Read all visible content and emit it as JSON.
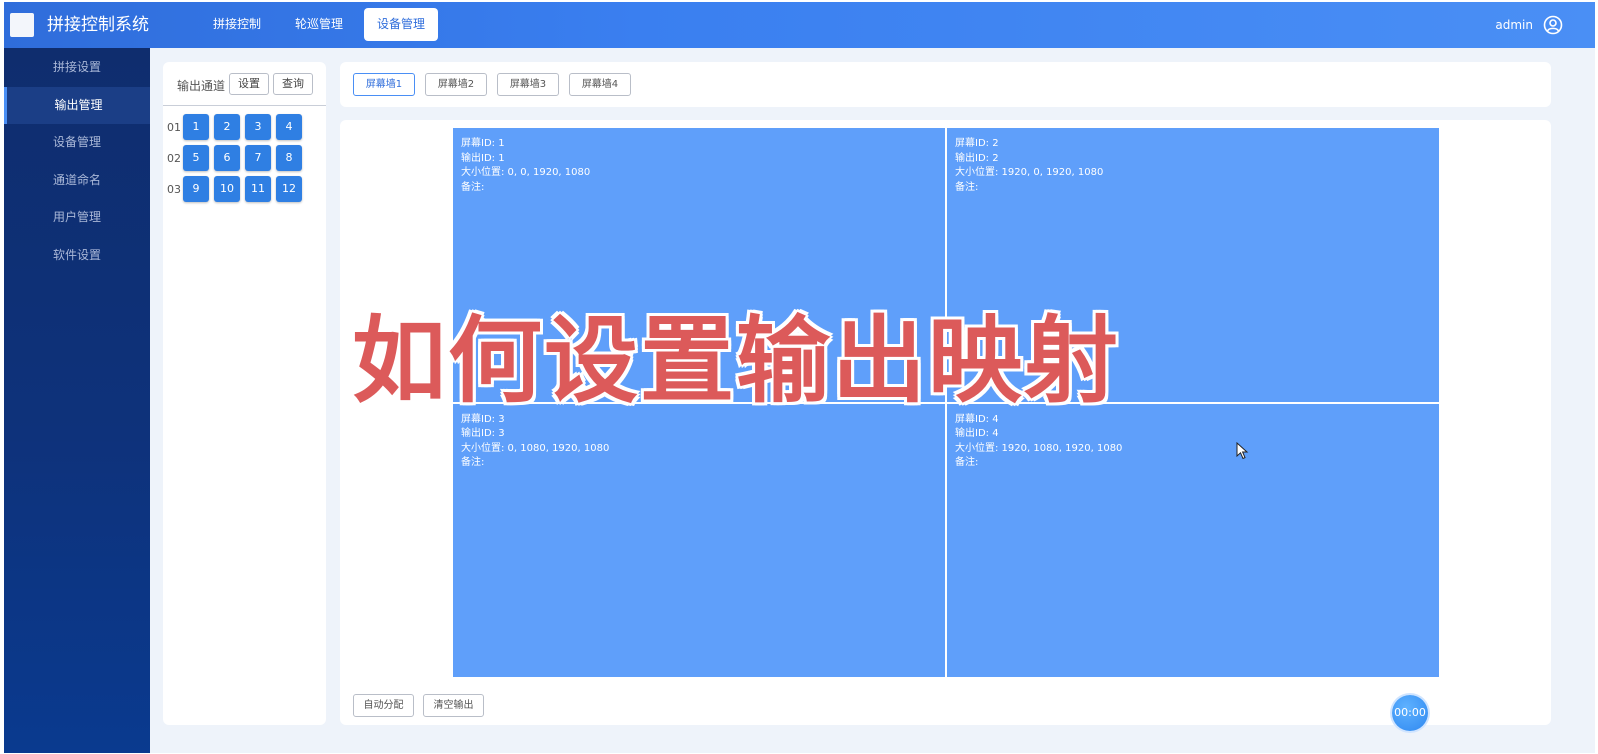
{
  "app": {
    "title": "拼接控制系统"
  },
  "nav": {
    "items": [
      {
        "label": "拼接控制"
      },
      {
        "label": "轮巡管理"
      },
      {
        "label": "设备管理",
        "active": true
      }
    ]
  },
  "user": {
    "name": "admin",
    "icon": "user-circle-icon"
  },
  "sidebar": {
    "items": [
      {
        "label": "拼接设置"
      },
      {
        "label": "输出管理",
        "active": true
      },
      {
        "label": "设备管理"
      },
      {
        "label": "通道命名"
      },
      {
        "label": "用户管理"
      },
      {
        "label": "软件设置"
      }
    ]
  },
  "channels": {
    "title": "输出通道",
    "set_label": "设置",
    "query_label": "查询",
    "rows": [
      {
        "label": "01",
        "buttons": [
          "1",
          "2",
          "3",
          "4"
        ]
      },
      {
        "label": "02",
        "buttons": [
          "5",
          "6",
          "7",
          "8"
        ]
      },
      {
        "label": "03",
        "buttons": [
          "9",
          "10",
          "11",
          "12"
        ]
      }
    ]
  },
  "walls": {
    "tabs": [
      {
        "label": "屏幕墙1",
        "active": true
      },
      {
        "label": "屏幕墙2"
      },
      {
        "label": "屏幕墙3"
      },
      {
        "label": "屏幕墙4"
      }
    ]
  },
  "screens": [
    {
      "screen_id": "屏幕ID: 1",
      "output_id": "输出ID: 1",
      "size_pos": "大小位置: 0, 0, 1920, 1080",
      "note": "备注:"
    },
    {
      "screen_id": "屏幕ID: 2",
      "output_id": "输出ID: 2",
      "size_pos": "大小位置: 1920, 0, 1920, 1080",
      "note": "备注:"
    },
    {
      "screen_id": "屏幕ID: 3",
      "output_id": "输出ID: 3",
      "size_pos": "大小位置: 0, 1080, 1920, 1080",
      "note": "备注:"
    },
    {
      "screen_id": "屏幕ID: 4",
      "output_id": "输出ID: 4",
      "size_pos": "大小位置: 1920, 1080, 1920, 1080",
      "note": "备注:"
    }
  ],
  "actions": {
    "auto_assign": "自动分配",
    "clear_output": "清空输出"
  },
  "overlay": {
    "text": "如何设置输出映射"
  },
  "timer": {
    "text": "00:00"
  },
  "colors": {
    "header": "#3a7ff0",
    "sidebar": "#0e327b",
    "screen": "#5f9ffa",
    "button": "#2f7fe3",
    "overlay_text": "#dc5a5a"
  }
}
